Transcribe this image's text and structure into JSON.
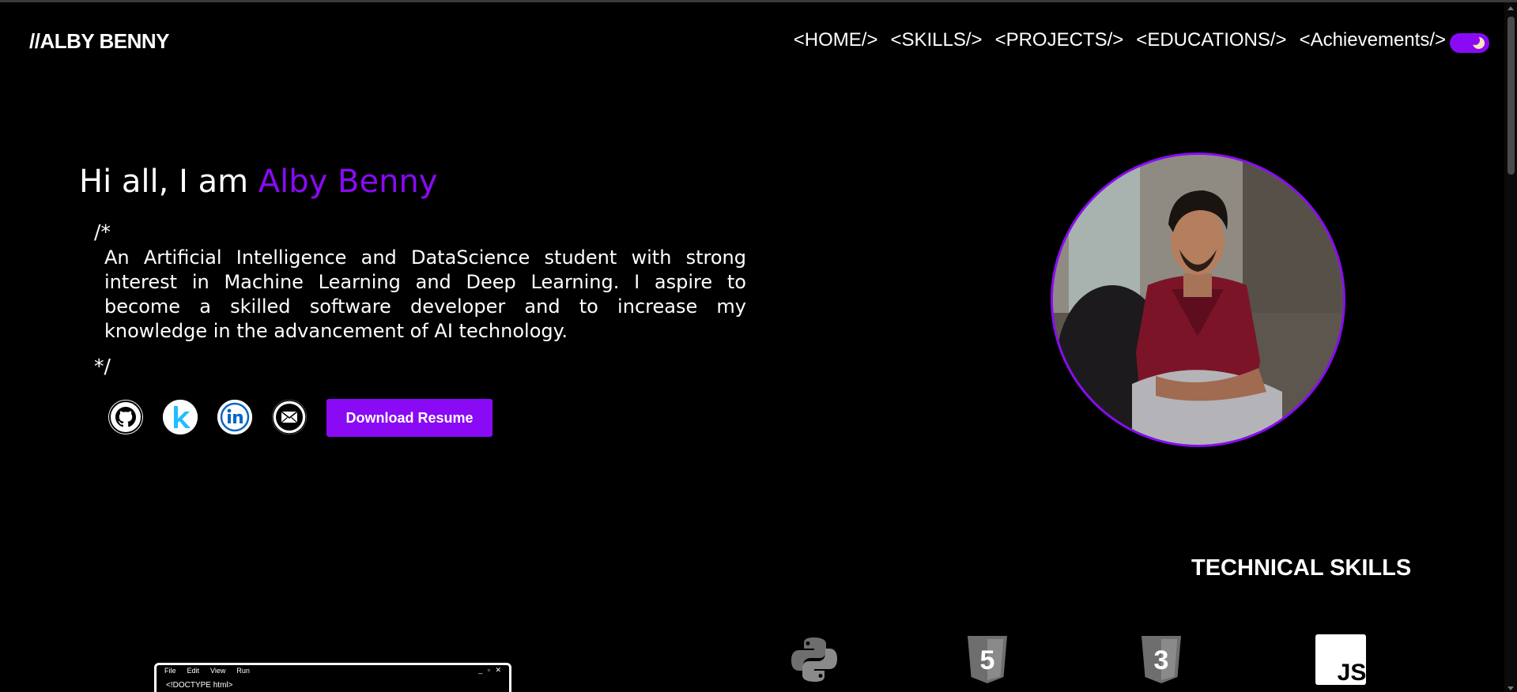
{
  "header": {
    "logo": "//ALBY BENNY",
    "nav": [
      {
        "label": "<HOME/>"
      },
      {
        "label": "<SKILLS/>"
      },
      {
        "label": "<PROJECTS/>"
      },
      {
        "label": "<EDUCATIONS/>"
      },
      {
        "label": "<Achievements/>"
      }
    ],
    "theme_toggle": {
      "icon": "moon-icon",
      "color": "#8a0af5"
    }
  },
  "hero": {
    "greeting_prefix": "Hi all, I am ",
    "name": "Alby Benny",
    "accent_color": "#8a0af5",
    "comment_open": "/*",
    "bio": "An Artificial Intelligence and DataScience student with strong interest in Machine Learning and Deep Learning. I aspire to become a skilled software developer and to increase my knowledge in the advancement of AI technology.",
    "comment_close": "*/",
    "socials": [
      {
        "icon": "github-icon"
      },
      {
        "icon": "kaggle-icon"
      },
      {
        "icon": "linkedin-icon"
      },
      {
        "icon": "email-icon"
      }
    ],
    "resume_button": "Download Resume",
    "avatar": {
      "icon": "profile-photo"
    }
  },
  "skills": {
    "title": "TECHNICAL SKILLS",
    "icons": [
      {
        "icon": "python-icon"
      },
      {
        "icon": "html5-icon",
        "label": "5"
      },
      {
        "icon": "css3-icon",
        "label": "3"
      },
      {
        "icon": "javascript-icon",
        "label": "JS"
      }
    ]
  },
  "editor": {
    "menu": [
      "File",
      "Edit",
      "View",
      "Run"
    ],
    "window_controls": "_ ▫ ✕",
    "code_line": "<!DOCTYPE html>"
  }
}
